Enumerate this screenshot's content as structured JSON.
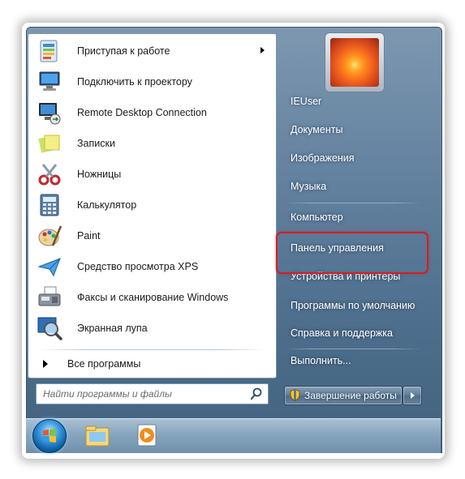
{
  "programs": [
    {
      "label": "Приступая к работе",
      "icon": "getting-started-icon",
      "has_submenu": true
    },
    {
      "label": "Подключить к проектору",
      "icon": "projector-icon",
      "has_submenu": false
    },
    {
      "label": "Remote Desktop Connection",
      "icon": "remote-desktop-icon",
      "has_submenu": false
    },
    {
      "label": "Записки",
      "icon": "sticky-notes-icon",
      "has_submenu": false
    },
    {
      "label": "Ножницы",
      "icon": "scissors-icon",
      "has_submenu": false
    },
    {
      "label": "Калькулятор",
      "icon": "calculator-icon",
      "has_submenu": false
    },
    {
      "label": "Paint",
      "icon": "paint-palette-icon",
      "has_submenu": false
    },
    {
      "label": "Средство просмотра XPS",
      "icon": "xps-viewer-icon",
      "has_submenu": false
    },
    {
      "label": "Факсы и сканирование Windows",
      "icon": "fax-scanner-icon",
      "has_submenu": false
    },
    {
      "label": "Экранная лупа",
      "icon": "magnifier-icon",
      "has_submenu": false
    }
  ],
  "all_programs": "Все программы",
  "search": {
    "placeholder": "Найти программы и файлы",
    "value": ""
  },
  "right_pane": {
    "user": "IEUser",
    "items": [
      "Документы",
      "Изображения",
      "Музыка",
      "Компьютер",
      "Панель управления",
      "Устройства и принтеры",
      "Программы по умолчанию",
      "Справка и поддержка",
      "Выполнить..."
    ]
  },
  "shutdown": {
    "label": "Завершение работы"
  },
  "taskbar": {
    "items": [
      {
        "icon": "start-orb-icon"
      },
      {
        "icon": "windows-explorer-icon"
      },
      {
        "icon": "media-player-icon"
      }
    ]
  },
  "colors": {
    "highlight": "#d21e28",
    "menu_bg": "#5f7f9d",
    "taskbar": "#87a5be"
  }
}
